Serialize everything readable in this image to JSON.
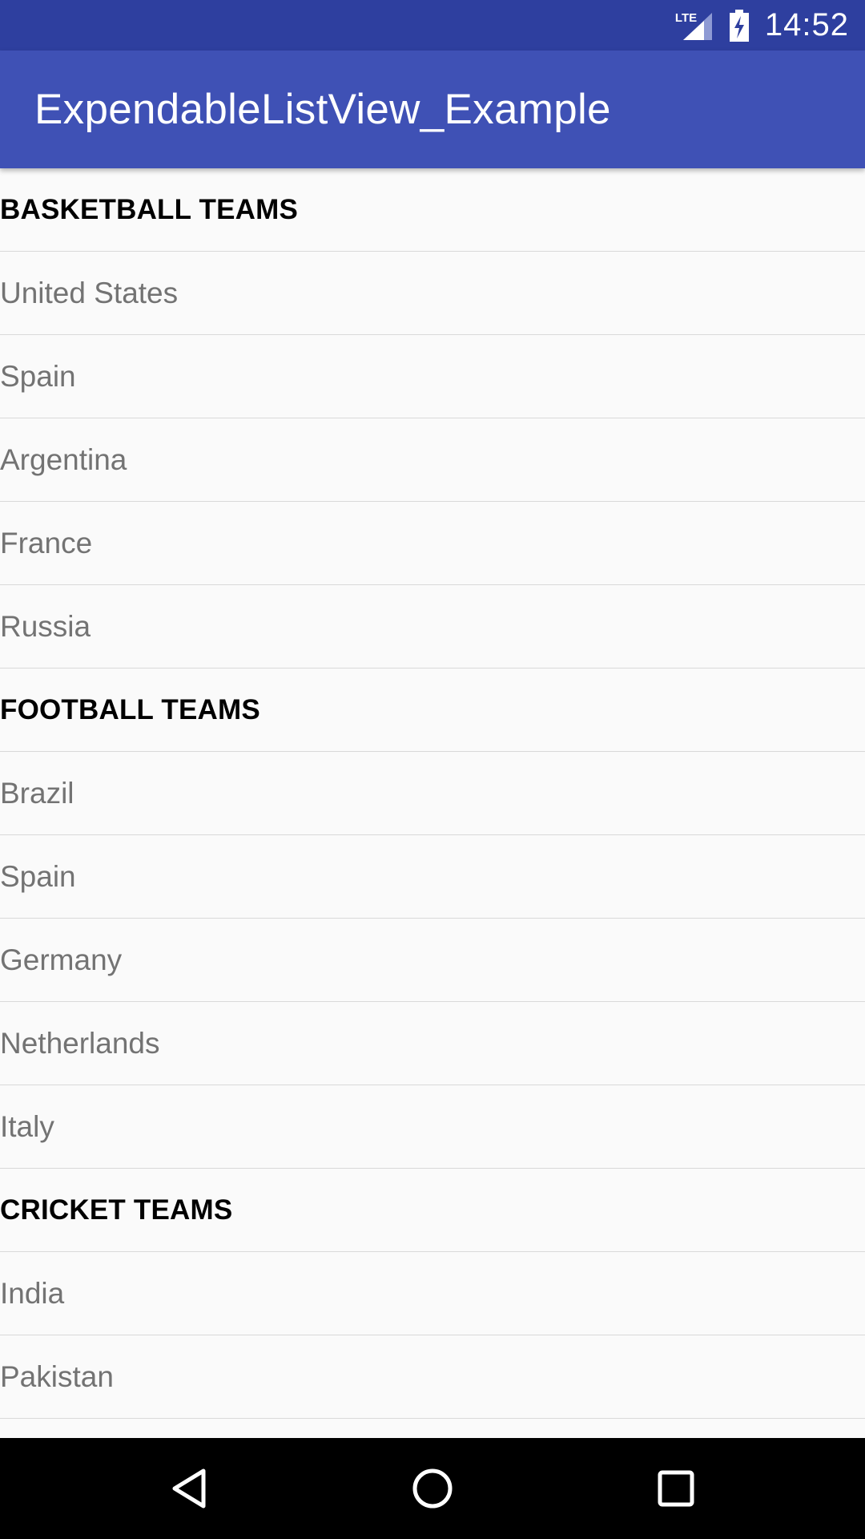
{
  "status_bar": {
    "time": "14:52",
    "network_label": "LTE",
    "icons": [
      "lte-signal-icon",
      "battery-charging-icon"
    ]
  },
  "app_bar": {
    "title": "ExpendableListView_Example"
  },
  "list": {
    "groups": [
      {
        "label": "BASKETBALL TEAMS",
        "children": [
          "United States",
          "Spain",
          "Argentina",
          "France",
          "Russia"
        ]
      },
      {
        "label": "FOOTBALL TEAMS",
        "children": [
          "Brazil",
          "Spain",
          "Germany",
          "Netherlands",
          "Italy"
        ]
      },
      {
        "label": "CRICKET TEAMS",
        "children": [
          "India",
          "Pakistan"
        ]
      }
    ]
  },
  "nav_bar": {
    "icons": [
      "back-icon",
      "home-icon",
      "recents-icon"
    ]
  },
  "colors": {
    "app_bar": "#3f51b5",
    "status_bar": "#2e3f9f",
    "background": "#fafafa",
    "group_text": "#000000",
    "child_text": "#737373"
  }
}
